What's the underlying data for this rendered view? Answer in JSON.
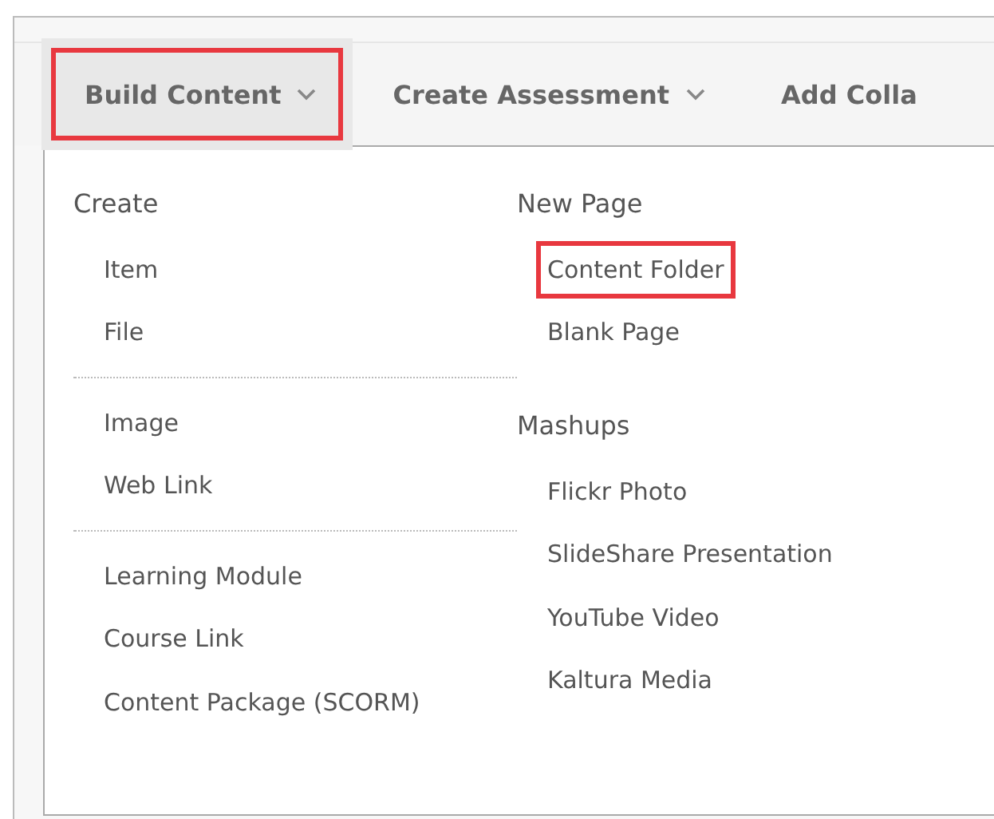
{
  "toolbar": {
    "tabs": [
      {
        "label": "Build Content",
        "selected": true,
        "highlighted": true
      },
      {
        "label": "Create Assessment",
        "selected": false,
        "highlighted": false
      },
      {
        "label": "Add Colla",
        "selected": false,
        "highlighted": false,
        "caret": false
      }
    ]
  },
  "menu": {
    "columns": [
      {
        "groups": [
          {
            "heading": "Create",
            "items": [
              {
                "label": "Item",
                "highlighted": false
              },
              {
                "label": "File",
                "highlighted": false
              }
            ]
          },
          {
            "items": [
              {
                "label": "Image",
                "highlighted": false
              },
              {
                "label": "Web Link",
                "highlighted": false
              }
            ]
          },
          {
            "items": [
              {
                "label": "Learning Module",
                "highlighted": false
              },
              {
                "label": "Course Link",
                "highlighted": false
              },
              {
                "label": "Content Package (SCORM)",
                "highlighted": false
              }
            ]
          }
        ]
      },
      {
        "groups": [
          {
            "heading": "New Page",
            "items": [
              {
                "label": "Content Folder",
                "highlighted": true
              },
              {
                "label": "Blank Page",
                "highlighted": false
              }
            ]
          },
          {
            "heading": "Mashups",
            "items": [
              {
                "label": "Flickr Photo",
                "highlighted": false
              },
              {
                "label": "SlideShare Presentation",
                "highlighted": false
              },
              {
                "label": "YouTube Video",
                "highlighted": false
              },
              {
                "label": "Kaltura Media",
                "highlighted": false
              }
            ]
          }
        ]
      }
    ]
  }
}
